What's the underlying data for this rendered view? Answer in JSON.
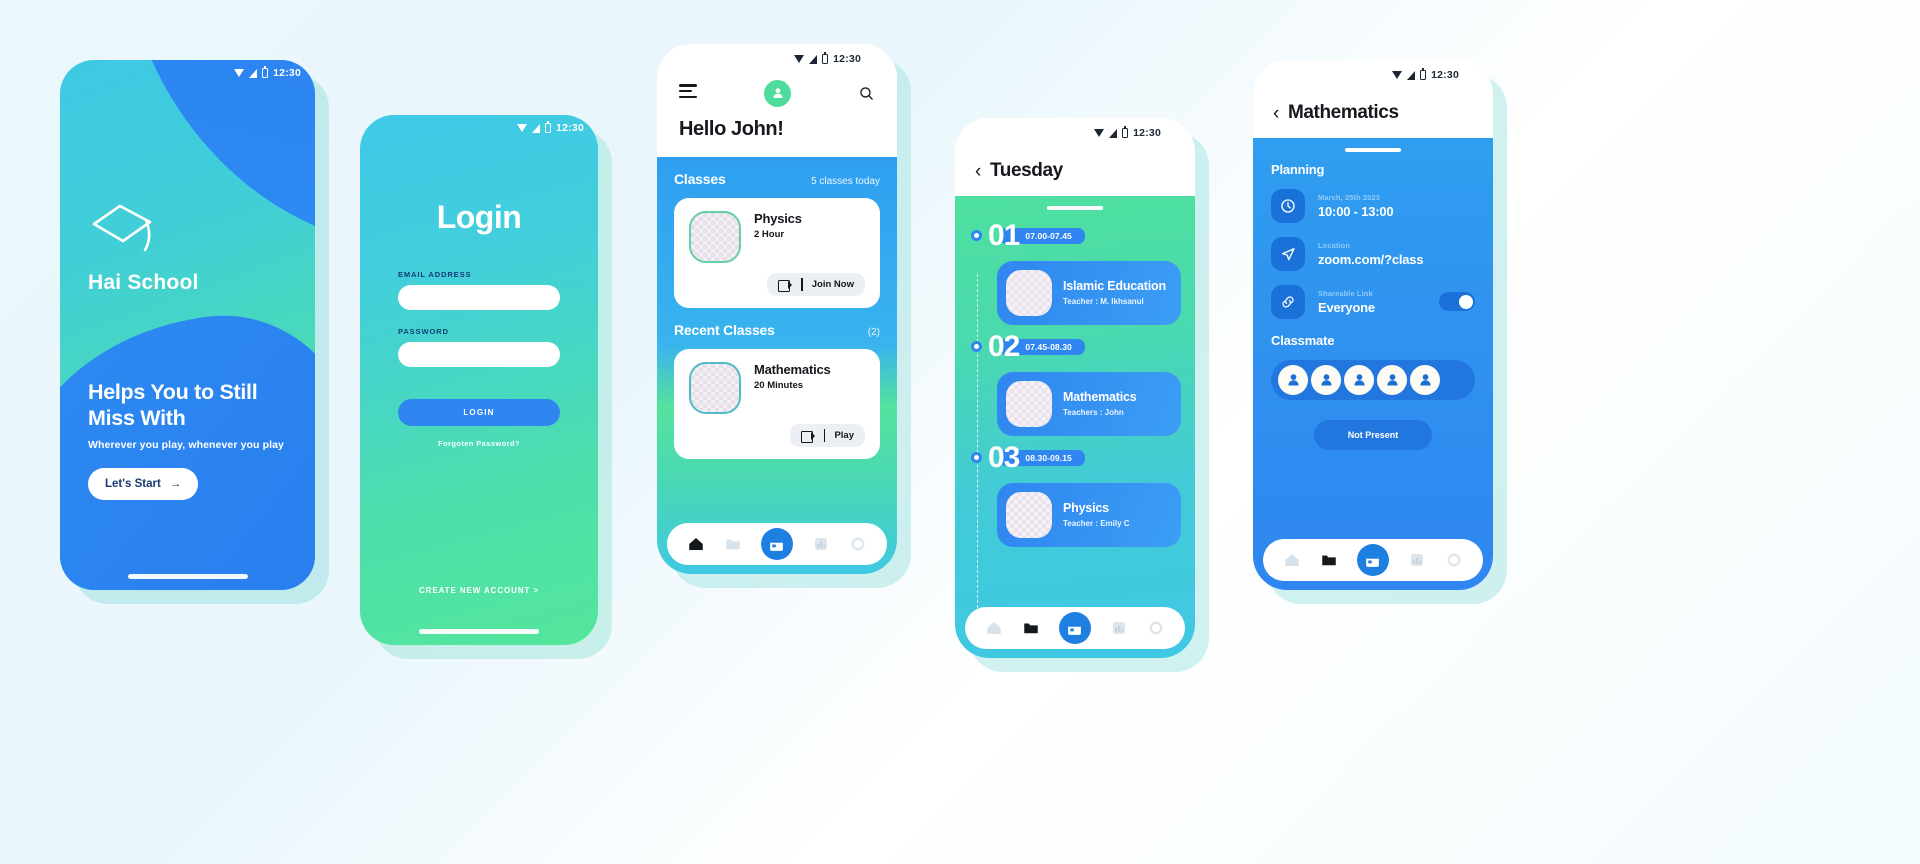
{
  "statusbar": {
    "time": "12:30"
  },
  "onboarding": {
    "brand": "Hai School",
    "headline": "Helps You to Still Miss With",
    "subline": "Wherever you play, whenever you play",
    "cta": "Let's Start",
    "arrow": "→"
  },
  "login": {
    "title": "Login",
    "email_label": "EMAIL ADDRESS",
    "email_value": "",
    "email_placeholder": "",
    "password_label": "PASSWORD",
    "password_value": "",
    "password_placeholder": "",
    "submit": "LOGIN",
    "forgot": "Forgoten Password?",
    "create_account": "CREATE NEW ACCOUNT >"
  },
  "home": {
    "greeting": "Hello John!",
    "classes": {
      "title": "Classes",
      "meta": "5 classes today",
      "item": {
        "name": "Physics",
        "duration": "2 Hour",
        "action": "Join Now"
      }
    },
    "recent": {
      "title": "Recent Classes",
      "meta": "(2)",
      "item": {
        "name": "Mathematics",
        "duration": "20 Minutes",
        "action": "Play"
      }
    }
  },
  "schedule": {
    "back": "‹",
    "title": "Tuesday",
    "slots": [
      {
        "num": "01",
        "time": "07.00-07.45",
        "name": "Islamic Education",
        "teacher": "Teacher : M. Ikhsanul"
      },
      {
        "num": "02",
        "time": "07.45-08.30",
        "name": "Mathematics",
        "teacher": "Teachers : John"
      },
      {
        "num": "03",
        "time": "08.30-09.15",
        "name": "Physics",
        "teacher": "Teacher : Emily C"
      }
    ]
  },
  "detail": {
    "back": "‹",
    "title": "Mathematics",
    "planning_label": "Planning",
    "rows": [
      {
        "icon": "clock-icon",
        "caption": "March, 25th 2023",
        "value": "10:00 - 13:00"
      },
      {
        "icon": "location-icon",
        "caption": "Location",
        "value": "zoom.com/?class"
      },
      {
        "icon": "link-icon",
        "caption": "Shareable Link",
        "value": "Everyone"
      }
    ],
    "classmate_label": "Classmate",
    "classmate_count": 5,
    "not_present": "Not Present"
  },
  "bottom_nav": {
    "items": [
      "home-icon",
      "folder-icon",
      "calendar-icon",
      "chart-icon",
      "gear-icon"
    ],
    "active_index": 2
  },
  "colors": {
    "blue": "#2f86f0",
    "deep_blue": "#1d7fe0",
    "teal": "#3fc8e4",
    "green": "#4ee09f",
    "navy": "#133d72"
  }
}
